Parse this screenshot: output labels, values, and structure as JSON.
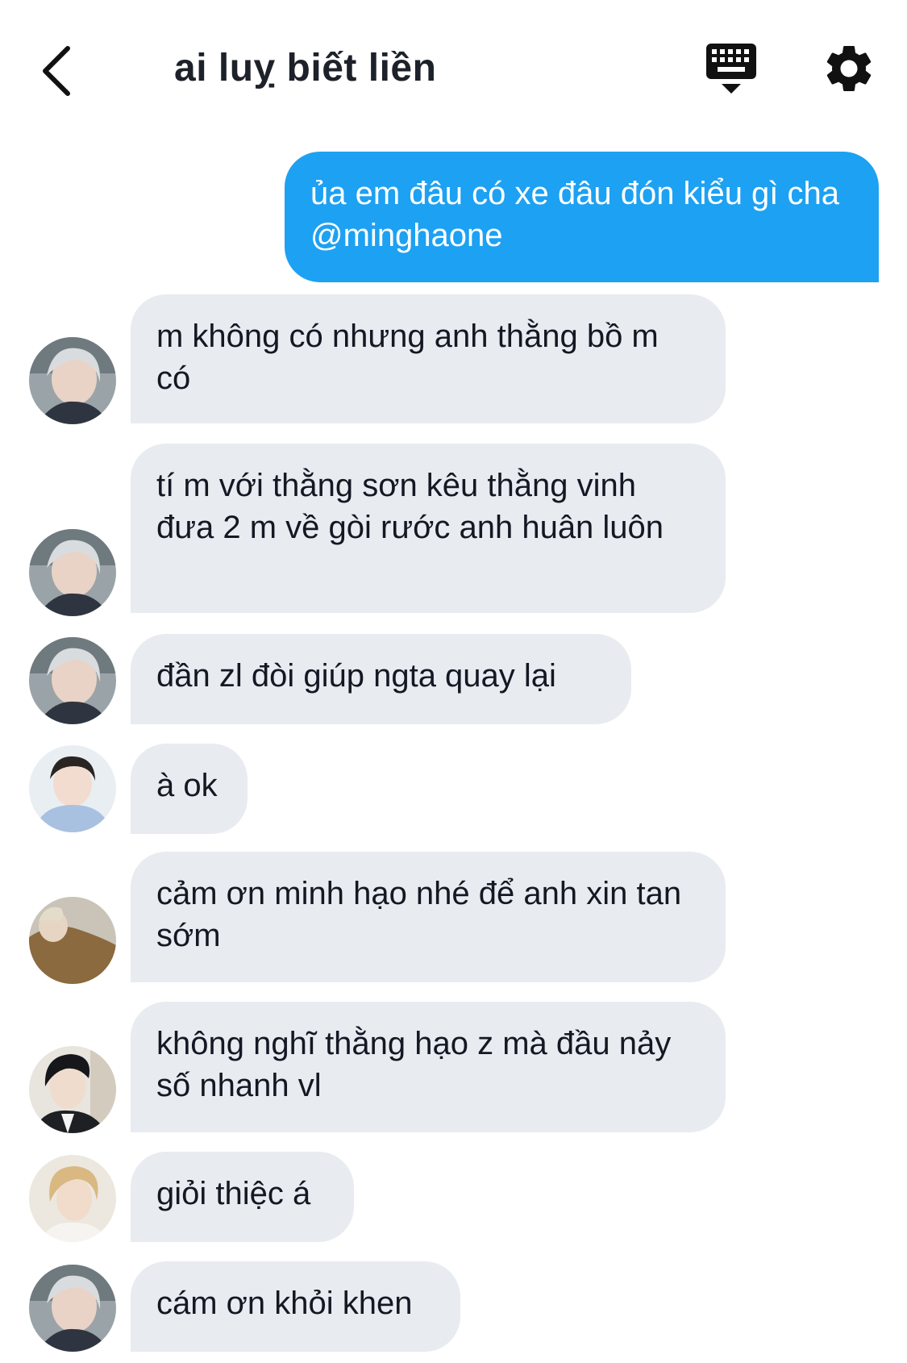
{
  "header": {
    "title": "ai luỵ biết liền",
    "back_icon": "chevron-left-icon",
    "keyboard_icon": "keyboard-hide-icon",
    "settings_icon": "gear-icon"
  },
  "colors": {
    "sent_bubble": "#1da1f2",
    "received_bubble": "#e8ebf0",
    "text": "#141823"
  },
  "messages": [
    {
      "text": "ủa em đâu có xe đâu đón kiểu gì cha @minghaone",
      "sender": "me"
    },
    {
      "text": "m không có nhưng anh thằng bồ m có",
      "sender": "silver-hair"
    },
    {
      "text": "tí m với thằng sơn kêu thằng vinh đưa 2 m về gòi rước anh huân luôn",
      "sender": "silver-hair"
    },
    {
      "text": "đần zl đòi giúp ngta quay lại",
      "sender": "silver-hair"
    },
    {
      "text": "à ok",
      "sender": "blue-hoodie"
    },
    {
      "text": "cảm ơn minh hạo nhé để anh xin tan sớm",
      "sender": "brown-jacket"
    },
    {
      "text": "không nghĩ thằng hạo z mà đầu nảy số nhanh vl",
      "sender": "dark-hair"
    },
    {
      "text": "giỏi thiệc á",
      "sender": "blonde"
    },
    {
      "text": "cám ơn khỏi khen",
      "sender": "silver-hair"
    }
  ]
}
